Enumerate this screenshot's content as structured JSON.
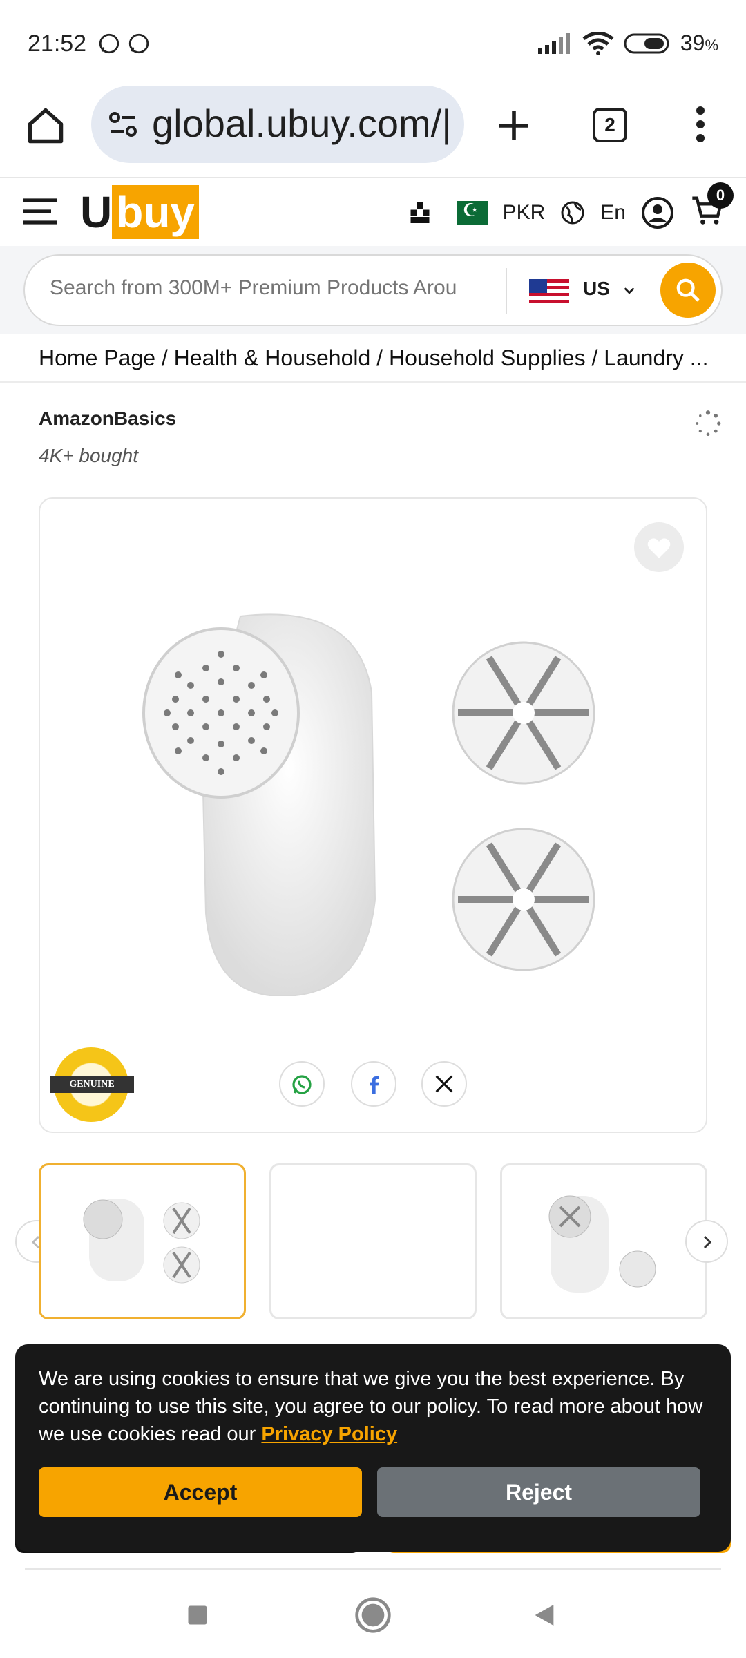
{
  "status_bar": {
    "time": "21:52",
    "battery": "39",
    "battery_unit": "%"
  },
  "browser": {
    "url": "global.ubuy.com/|",
    "tab_count": "2"
  },
  "site_header": {
    "logo_prefix": "U",
    "logo_suffix": "buy",
    "currency": "PKR",
    "language": "En",
    "cart_count": "0"
  },
  "search": {
    "placeholder": "Search from 300M+ Premium Products Arou",
    "store_country": "US"
  },
  "breadcrumb": "Home Page / Health & Household / Household Supplies / Laundry ...",
  "product": {
    "brand": "AmazonBasics",
    "bought": "4K+ bought",
    "badge_text": "GENUINE"
  },
  "cookie_banner": {
    "message": "We are using cookies to ensure that we give you the best experience. By continuing to use this site, you agree to our policy. To read more about how we use cookies read our",
    "link_text": "Privacy Policy",
    "accept_label": "Accept",
    "reject_label": "Reject"
  },
  "colors": {
    "brand_accent": "#f7a400",
    "dark": "#181818",
    "reject_gray": "#6b7176"
  },
  "icons": [
    "home-icon",
    "site-settings-icon",
    "plus-icon",
    "more-icon",
    "menu-icon",
    "warehouse-icon",
    "globe-icon",
    "account-icon",
    "cart-icon",
    "chevron-down-icon",
    "search-icon",
    "loading-icon",
    "heart-icon",
    "whatsapp-icon",
    "facebook-icon",
    "x-icon",
    "chevron-left-icon",
    "chevron-right-icon",
    "recents-icon",
    "home-nav-icon",
    "back-icon"
  ]
}
